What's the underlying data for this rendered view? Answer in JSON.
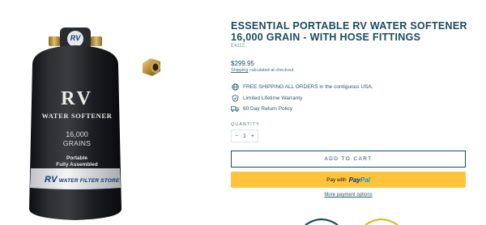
{
  "product": {
    "title": "ESSENTIAL PORTABLE RV WATER SOFTENER 16,000 GRAIN - WITH HOSE FITTINGS",
    "sku": "E4112",
    "price": "$299.95",
    "shipping_note_link": "Shipping",
    "shipping_note_rest": " calculated at checkout."
  },
  "perks": [
    {
      "icon": "globe-icon",
      "text": "FREE SHIPPING ALL ORDERS in the contiguous USA."
    },
    {
      "icon": "shield-icon",
      "text": "Limited Lifetime Warranty"
    },
    {
      "icon": "truck-icon",
      "text": "60 Day Return Policy"
    }
  ],
  "quantity": {
    "label": "QUANTITY",
    "minus": "−",
    "value": "1",
    "plus": "+"
  },
  "buttons": {
    "add_to_cart": "ADD TO CART",
    "pay_with": "Pay with",
    "paypal_pay": "Pay",
    "paypal_pal": "Pal",
    "more_payment": "More payment options"
  },
  "tank_label": {
    "cap_logo": "RV",
    "rv": "RV",
    "water_softener": "WATER SOFTENER",
    "grains_number": "16,000",
    "grains_word": "GRAINS",
    "portable": "Portable",
    "fully_assembled": "Fully Assembled",
    "brand_initials": "RV",
    "brand_name": "WATER FILTER STORE"
  },
  "colors": {
    "text": "#1d4e5f",
    "paypal_yellow": "#ffc439",
    "tank": "#1e1f21"
  }
}
